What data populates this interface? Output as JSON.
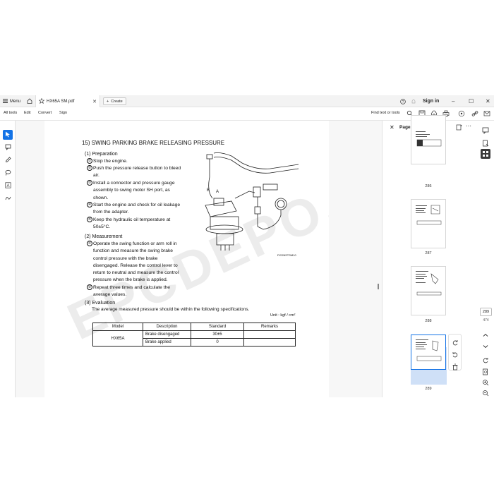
{
  "titlebar": {
    "menu_label": "Menu",
    "tab_title": "HX65A SM.pdf",
    "create_label": "Create",
    "signin_label": "Sign in"
  },
  "toolbar": {
    "items": [
      "All tools",
      "Edit",
      "Convert",
      "Sign"
    ],
    "find_label": "Find text or tools"
  },
  "document": {
    "watermark": "EPCDEPO.COM",
    "procedure_title": "15) SWING PARKING BRAKE RELEASING PRESSURE",
    "section1": "(1) Preparation",
    "prep_steps": [
      {
        "n": "①",
        "text": "Stop the engine."
      },
      {
        "n": "②",
        "text": "Push the pressure release button to bleed air."
      },
      {
        "n": "③",
        "text": "Install a connector and pressure gauge assembly to swing motor SH port, as shown."
      },
      {
        "n": "④",
        "text": "Start the engine and check for oil leakage from the adapter."
      },
      {
        "n": "⑤",
        "text": "Keep the hydraulic oil temperature at 50±5°C."
      }
    ],
    "section2": "(2) Measurement",
    "meas_steps": [
      {
        "n": "①",
        "text": "Operate the swing function or arm roll in function and measure the swing brake control pressure with the brake disengaged. Release the control lever to return to neutral and measure the control pressure when the brake is applied."
      },
      {
        "n": "②",
        "text": "Repeat three times and calculate the average values."
      }
    ],
    "section3": "(3) Evaluation",
    "eval_text": "The average measured pressure should be within the following specifications.",
    "unit": "Unit : kgf / cm²",
    "figure_id": "FIG26STSM10",
    "figure_labels": {
      "b": "B",
      "a": "A"
    },
    "table": {
      "headers": [
        "Model",
        "Description",
        "Standard",
        "Remarks"
      ],
      "model": "HX65A",
      "rows": [
        {
          "description": "Brake disengaged",
          "standard": "30±5",
          "remarks": ""
        },
        {
          "description": "Brake applied",
          "standard": "0",
          "remarks": ""
        }
      ]
    }
  },
  "pages_panel": {
    "title": "Pages",
    "thumbs": [
      {
        "label": "286"
      },
      {
        "label": "287"
      },
      {
        "label": "288"
      },
      {
        "label": "289",
        "selected": true
      }
    ]
  },
  "navigation": {
    "current_page": "289",
    "total_pages": "474"
  },
  "colors": {
    "accent": "#1473e6",
    "selected_thumb_bg": "#cfe0f7"
  }
}
